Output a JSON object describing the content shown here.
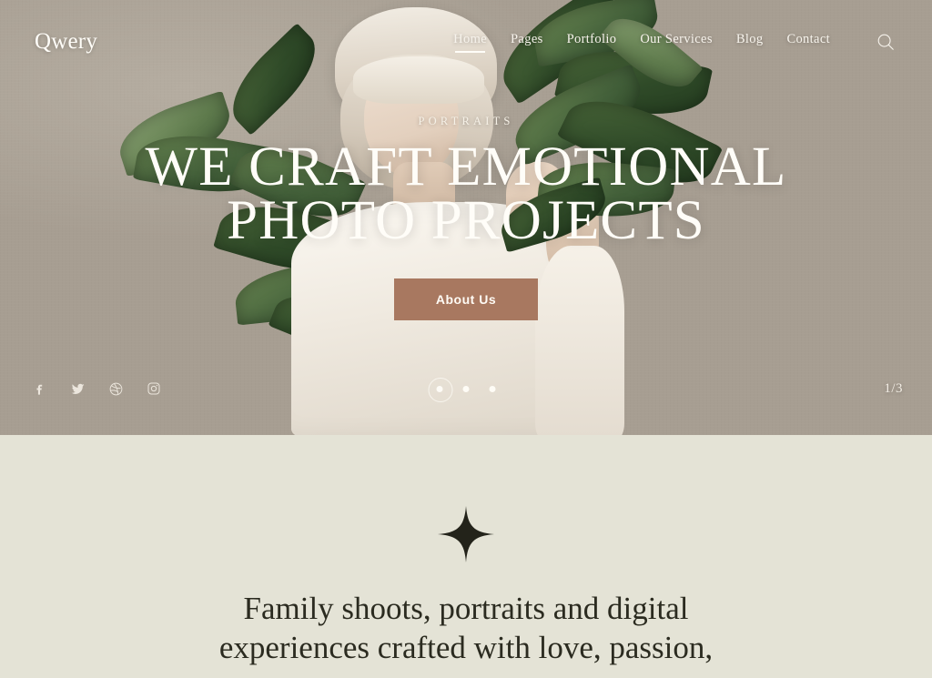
{
  "header": {
    "logo": "Qwery",
    "nav": [
      {
        "label": "Home",
        "active": true
      },
      {
        "label": "Pages",
        "active": false
      },
      {
        "label": "Portfolio",
        "active": false
      },
      {
        "label": "Our Services",
        "active": false
      },
      {
        "label": "Blog",
        "active": false
      },
      {
        "label": "Contact",
        "active": false
      }
    ],
    "search_icon": "search-icon"
  },
  "hero": {
    "subtitle": "PORTRAITS",
    "headline_line1": "WE CRAFT EMOTIONAL",
    "headline_line2": "PHOTO PROJECTS",
    "cta_label": "About Us",
    "socials": [
      {
        "name": "facebook-icon",
        "glyph": "f"
      },
      {
        "name": "twitter-icon",
        "glyph": "t"
      },
      {
        "name": "dribbble-icon",
        "glyph": "d"
      },
      {
        "name": "instagram-icon",
        "glyph": "i"
      }
    ],
    "slides": [
      {
        "active": true
      },
      {
        "active": false
      },
      {
        "active": false
      }
    ],
    "counter": "1/3",
    "image_alt": "Blonde woman in white garment holding large green leaves against a beige wall"
  },
  "intro": {
    "ornament": "four-point-star-icon",
    "text": "Family shoots, portraits and digital experiences crafted with love, passion,"
  },
  "colors": {
    "hero_background": "#ABA296",
    "section_background": "#E4E3D6",
    "accent": "#A87860",
    "text_light": "#FFFDF8",
    "text_dark": "#2B2B20",
    "foliage": "#2F4A28"
  }
}
